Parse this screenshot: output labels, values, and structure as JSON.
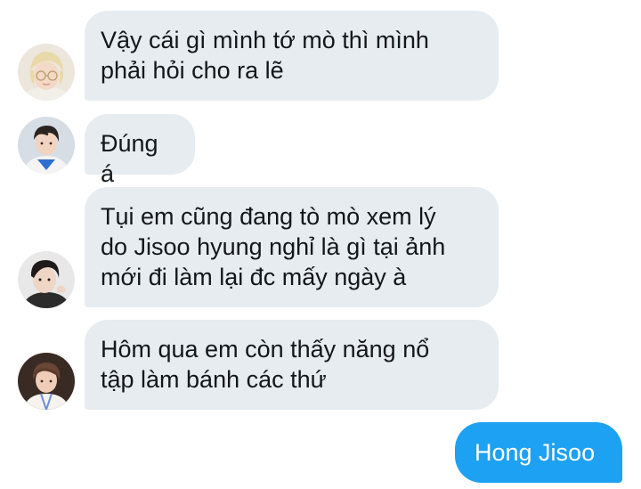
{
  "conversation": {
    "messages": [
      {
        "sender": "incoming",
        "avatar_icon": "avatar-blonde-glasses",
        "text": "Vậy cái gì mình tớ mò thì mình\nphải hỏi cho ra lẽ"
      },
      {
        "sender": "incoming",
        "avatar_icon": "avatar-dark-hair-white-jacket",
        "text": "Đúng á"
      },
      {
        "sender": "incoming",
        "avatar_icon": "avatar-dark-hair-portrait",
        "text": "Tụi em cũng đang tò mò xem lý\ndo Jisoo hyung nghỉ là gì tại ảnh\nmới đi làm lại đc mấy ngày à"
      },
      {
        "sender": "incoming",
        "avatar_icon": "avatar-brown-hair-lanyard",
        "text": "Hôm qua em còn thấy năng nổ\ntập làm bánh các thứ"
      },
      {
        "sender": "outgoing",
        "text": "Hong Jisoo"
      }
    ]
  },
  "colors": {
    "incoming_bubble": "#e6ecf0",
    "outgoing_bubble": "#1da1f2",
    "incoming_text": "#14171a",
    "outgoing_text": "#ffffff"
  }
}
